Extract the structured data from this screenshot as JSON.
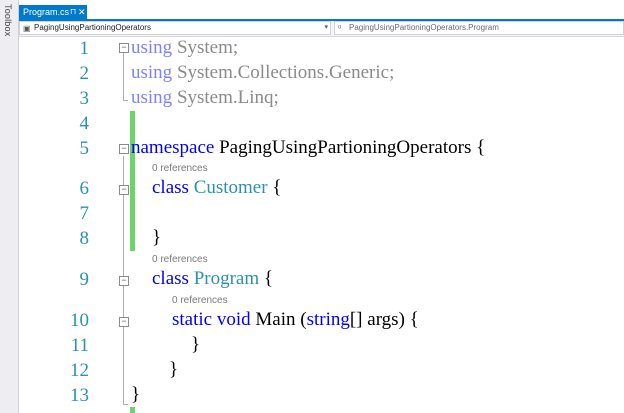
{
  "toolbox": {
    "label": "Toolbox"
  },
  "tab": {
    "title": "Program.cs",
    "pin": "⊓",
    "close": "✕"
  },
  "navbar": {
    "project": "PagingUsingPartioningOperators",
    "member": "PagingUsingPartioningOperators.Program",
    "project_icon": "csharp-project-icon",
    "member_icon": "class-icon"
  },
  "code": {
    "line_numbers": [
      "1",
      "2",
      "3",
      "4",
      "5",
      "6",
      "7",
      "8",
      "9",
      "10",
      "11",
      "12",
      "13"
    ],
    "lines": {
      "l1_kw": "using",
      "l1_rest": " System;",
      "l2_kw": "using",
      "l2_rest": " System.Collections.Generic;",
      "l3_kw": "using",
      "l3_rest": " System.Linq;",
      "l5_kw": "namespace",
      "l5_rest": " PagingUsingPartioningOperators {",
      "l6_kw": "class",
      "l6_type": "Customer",
      "l6_rest": " {",
      "l8": "}",
      "l9_kw": "class",
      "l9_type": "Program",
      "l9_rest": " {",
      "l10_kw1": "static",
      "l10_kw2": "void",
      "l10_mid": " Main (",
      "l10_kw3": "string",
      "l10_rest": "[] args) {",
      "l11": "}",
      "l12": "}",
      "l13": "}"
    },
    "codelens": {
      "customer": "0 references",
      "program": "0 references",
      "main": "0 references"
    }
  },
  "colors": {
    "accent": "#007acc",
    "keyword": "#0000ff",
    "type": "#2b91af",
    "line_number": "#2b91af",
    "change_bar": "#6dd36d"
  }
}
